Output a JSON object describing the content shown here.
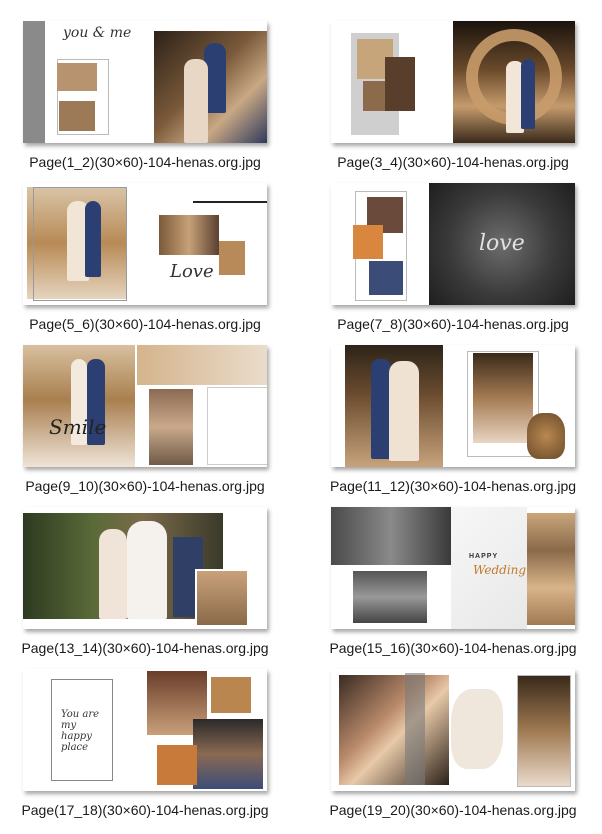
{
  "files": [
    {
      "name": "Page(1_2)(30×60)-104-henas.org.jpg"
    },
    {
      "name": "Page(3_4)(30×60)-104-henas.org.jpg"
    },
    {
      "name": "Page(5_6)(30×60)-104-henas.org.jpg"
    },
    {
      "name": "Page(7_8)(30×60)-104-henas.org.jpg"
    },
    {
      "name": "Page(9_10)(30×60)-104-henas.org.jpg"
    },
    {
      "name": "Page(11_12)(30×60)-104-henas.org.jpg"
    },
    {
      "name": "Page(13_14)(30×60)-104-henas.org.jpg"
    },
    {
      "name": "Page(15_16)(30×60)-104-henas.org.jpg"
    },
    {
      "name": "Page(17_18)(30×60)-104-henas.org.jpg"
    },
    {
      "name": "Page(19_20)(30×60)-104-henas.org.jpg"
    }
  ],
  "thumb_text": {
    "t1_script": "you & me",
    "t3_script": "Love",
    "t4_script": "love",
    "t5_script": "Smile",
    "t8_happy": "HAPPY",
    "t8_wedding": "Wedding",
    "t9_quote": "You are my happy place"
  }
}
